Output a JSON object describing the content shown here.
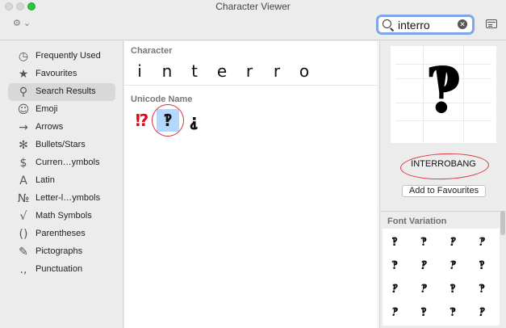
{
  "window": {
    "title": "Character Viewer",
    "action_menu": "⚙︎ ⌄"
  },
  "search": {
    "value": "interro",
    "placeholder": "Search"
  },
  "sidebar": {
    "items": [
      {
        "label": "Frequently Used",
        "icon": "clock-icon",
        "glyph": "◷",
        "selected": false
      },
      {
        "label": "Favourites",
        "icon": "star-icon",
        "glyph": "★",
        "selected": false
      },
      {
        "label": "Search Results",
        "icon": "search-icon",
        "glyph": "⚲",
        "selected": true
      },
      {
        "label": "Emoji",
        "icon": "smiley-icon",
        "glyph": "☺",
        "selected": false
      },
      {
        "label": "Arrows",
        "icon": "arrow-icon",
        "glyph": "→",
        "selected": false
      },
      {
        "label": "Bullets/Stars",
        "icon": "asterisk-icon",
        "glyph": "✻",
        "selected": false
      },
      {
        "label": "Curren…ymbols",
        "icon": "dollar-icon",
        "glyph": "$",
        "selected": false
      },
      {
        "label": "Latin",
        "icon": "latin-a-icon",
        "glyph": "A",
        "selected": false
      },
      {
        "label": "Letter-l…ymbols",
        "icon": "numero-icon",
        "glyph": "№",
        "selected": false
      },
      {
        "label": "Math Symbols",
        "icon": "sqrt-icon",
        "glyph": "√",
        "selected": false
      },
      {
        "label": "Parentheses",
        "icon": "parentheses-icon",
        "glyph": "()",
        "selected": false
      },
      {
        "label": "Pictographs",
        "icon": "pictograph-icon",
        "glyph": "✎",
        "selected": false
      },
      {
        "label": "Punctuation",
        "icon": "punctuation-icon",
        "glyph": ".,",
        "selected": false
      }
    ]
  },
  "middle": {
    "character_header": "Character",
    "characters": [
      "i",
      "n",
      "t",
      "e",
      "r",
      "r",
      "o"
    ],
    "unicode_header": "Unicode Name",
    "results": [
      {
        "glyph": "⁉",
        "color": "#d80c1c",
        "selected": false
      },
      {
        "glyph": "‽",
        "color": "#111111",
        "selected": true
      },
      {
        "glyph": "⸘",
        "color": "#111111",
        "selected": false
      }
    ]
  },
  "detail": {
    "preview_glyph": "‽",
    "name": "INTERROBANG",
    "fav_button": "Add to Favourites",
    "font_variation_header": "Font Variation",
    "variations": [
      "‽",
      "‽",
      "‽",
      "‽",
      "‽",
      "‽",
      "‽",
      "‽",
      "‽",
      "‽",
      "‽",
      "‽",
      "‽",
      "‽",
      "‽",
      "‽"
    ]
  },
  "colors": {
    "selection": "#b3d7fd",
    "annotation": "#d9333f",
    "search_focus": "#7fa6e8"
  }
}
